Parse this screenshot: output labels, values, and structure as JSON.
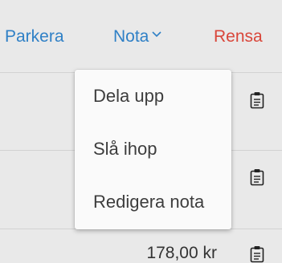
{
  "toolbar": {
    "park_label": "Parkera",
    "note_label": "Nota",
    "clear_label": "Rensa"
  },
  "note_menu": {
    "items": [
      {
        "label": "Dela upp"
      },
      {
        "label": "Slå ihop"
      },
      {
        "label": "Redigera nota"
      }
    ]
  },
  "rows": [
    {
      "amount": "",
      "icon": "clipboard-icon"
    },
    {
      "amount": "",
      "icon": "clipboard-icon"
    },
    {
      "amount": "178,00 kr",
      "icon": "clipboard-icon"
    }
  ],
  "colors": {
    "link_blue": "#2f80c6",
    "danger_red": "#d9463a",
    "background": "#e9e9e9",
    "menu_background": "#fafafa"
  }
}
